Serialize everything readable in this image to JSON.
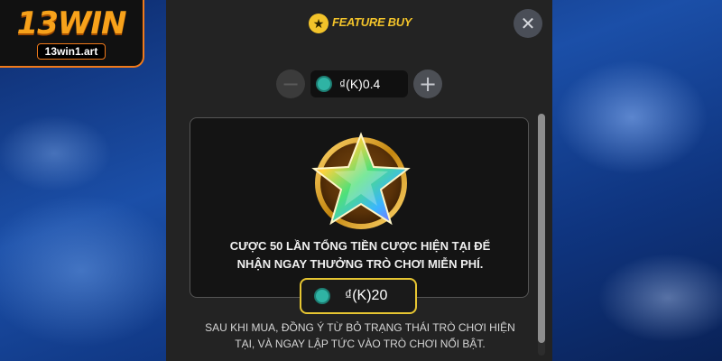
{
  "logo": {
    "brand": "13WIN",
    "url": "13win1.art"
  },
  "dialog": {
    "title": "FEATURE BUY",
    "title_icon": "star-icon",
    "close_icon": "close-icon"
  },
  "bet": {
    "decrement_icon": "minus-icon",
    "increment_icon": "plus-icon",
    "value": "₫(K)0.4",
    "currency_icon": "coin-icon"
  },
  "feature": {
    "emblem_icon": "rainbow-star-medal-icon",
    "line1": "CƯỢC 50 LẦN TỔNG TIỀN CƯỢC HIỆN TẠI ĐỂ",
    "line2": "NHẬN NGAY THƯỞNG TRÒ CHƠI MIỄN PHÍ."
  },
  "purchase": {
    "price": "₫(K)20",
    "currency_icon": "coin-icon"
  },
  "footer": {
    "line1": "SAU KHI MUA, ĐỒNG Ý TỪ BỎ TRẠNG THÁI TRÒ CHƠI HIỆN",
    "line2": "TẠI, VÀ NGAY LẬP TỨC VÀO TRÒ CHƠI NỔI BẬT."
  },
  "colors": {
    "accent_gold": "#f2c32a",
    "brand_orange": "#f07a1a",
    "panel_bg": "#232323"
  }
}
